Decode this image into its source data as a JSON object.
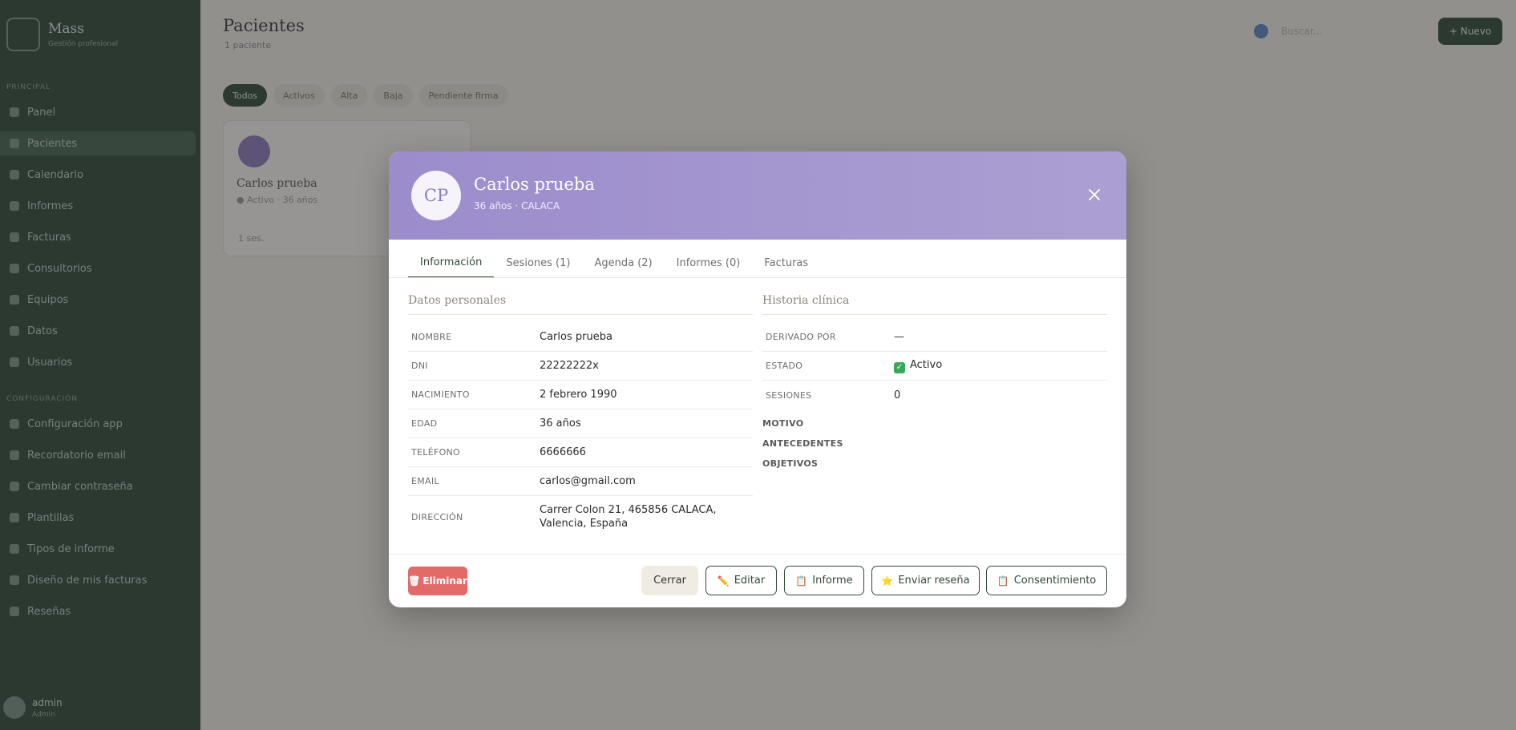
{
  "background": {
    "brand_name": "Mass",
    "brand_sub": "Gestión profesional",
    "section_main": "PRINCIPAL",
    "section_config": "CONFIGURACIÓN",
    "sidebar_items": [
      {
        "label": "Panel"
      },
      {
        "label": "Pacientes"
      },
      {
        "label": "Calendario"
      },
      {
        "label": "Informes"
      },
      {
        "label": "Facturas"
      },
      {
        "label": "Consultorios"
      },
      {
        "label": "Equipos"
      },
      {
        "label": "Datos"
      },
      {
        "label": "Usuarios"
      }
    ],
    "config_items": [
      {
        "label": "Configuración app"
      },
      {
        "label": "Recordatorio email"
      },
      {
        "label": "Cambiar contraseña"
      },
      {
        "label": "Plantillas"
      },
      {
        "label": "Tipos de informe"
      },
      {
        "label": "Diseño de mis facturas"
      },
      {
        "label": "Reseñas"
      }
    ],
    "user_name": "admin",
    "user_role": "Admin",
    "page_title": "Pacientes",
    "page_sub": "1 paciente",
    "search_placeholder": "Buscar...",
    "new_button": "+ Nuevo",
    "filters": [
      "Todos",
      "Activos",
      "Alta",
      "Baja",
      "Pendiente firma"
    ],
    "card_name": "Carlos prueba",
    "card_meta": "● Activo · 36 años",
    "card_foot": "1 ses."
  },
  "modal": {
    "initials": "CP",
    "name": "Carlos prueba",
    "subtitle": "36 años · CALACA",
    "tabs": [
      "Información",
      "Sesiones (1)",
      "Agenda (2)",
      "Informes (0)",
      "Facturas"
    ],
    "personal_title": "Datos personales",
    "clinical_title": "Historia clínica",
    "personal": [
      {
        "label": "NOMBRE",
        "value": "Carlos prueba"
      },
      {
        "label": "DNI",
        "value": "22222222x"
      },
      {
        "label": "NACIMIENTO",
        "value": "2 febrero 1990"
      },
      {
        "label": "EDAD",
        "value": "36 años"
      },
      {
        "label": "TELÉFONO",
        "value": "6666666"
      },
      {
        "label": "EMAIL",
        "value": "carlos@gmail.com"
      },
      {
        "label": "DIRECCIÓN",
        "value": "Carrer Colon 21, 465856 CALACA, Valencia, España"
      }
    ],
    "clinical": [
      {
        "label": "DERIVADO POR",
        "value": "—"
      },
      {
        "label": "ESTADO",
        "value": "Activo"
      },
      {
        "label": "SESIONES",
        "value": "0"
      }
    ],
    "clinical_extra": [
      "MOTIVO",
      "ANTECEDENTES",
      "OBJETIVOS"
    ],
    "buttons": {
      "delete": "Eliminar",
      "close": "Cerrar",
      "edit": "Editar",
      "report": "Informe",
      "review": "Enviar reseña",
      "consent": "Consentimiento"
    },
    "icons": {
      "delete": "trash-icon",
      "edit": "pencil-icon",
      "report": "clipboard-icon",
      "review": "star-icon",
      "consent": "clipboard-icon"
    }
  }
}
